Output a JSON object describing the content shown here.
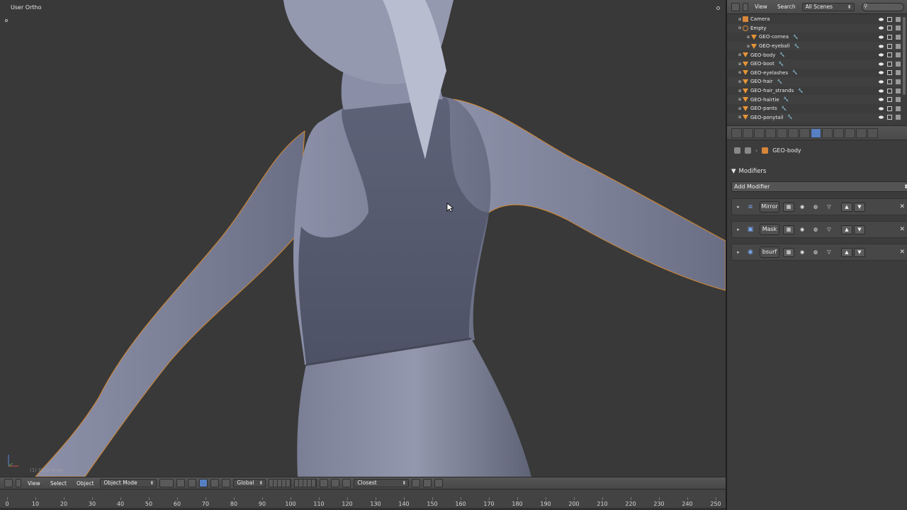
{
  "viewport": {
    "title": "User Ortho",
    "object_label": "(1) GEO-body",
    "header": {
      "view": "View",
      "select": "Select",
      "object": "Object",
      "mode": "Object Mode",
      "orientation": "Global",
      "snap": "Closest"
    }
  },
  "timeline": {
    "ticks": [
      "0",
      "10",
      "20",
      "30",
      "40",
      "50",
      "60",
      "70",
      "80",
      "90",
      "100",
      "110",
      "120",
      "130",
      "140",
      "150",
      "160",
      "170",
      "180",
      "190",
      "200",
      "210",
      "220",
      "230",
      "240",
      "250"
    ]
  },
  "outliner": {
    "view": "View",
    "search": "Search",
    "scene_select": "All Scenes",
    "items": [
      {
        "name": "Camera",
        "type": "camera"
      },
      {
        "name": "Empty",
        "type": "empty"
      },
      {
        "name": "GEO-cornea",
        "type": "mesh"
      },
      {
        "name": "GEO-eyeball",
        "type": "mesh"
      },
      {
        "name": "GEO-body",
        "type": "mesh"
      },
      {
        "name": "GEO-boot",
        "type": "mesh"
      },
      {
        "name": "GEO-eyelashes",
        "type": "mesh"
      },
      {
        "name": "GEO-hair",
        "type": "mesh"
      },
      {
        "name": "GEO-hair_strands",
        "type": "mesh"
      },
      {
        "name": "GEO-hairtie",
        "type": "mesh"
      },
      {
        "name": "GEO-pants",
        "type": "mesh"
      },
      {
        "name": "GEO-ponytail",
        "type": "mesh"
      }
    ]
  },
  "properties": {
    "context": "GEO-body",
    "panel_title": "Modifiers",
    "add_modifier": "Add Modifier",
    "modifiers": [
      {
        "name": "Mirror",
        "icon": "mirror-icon"
      },
      {
        "name": "Mask",
        "icon": "mask-icon"
      },
      {
        "name": "bsurf",
        "icon": "subsurf-icon"
      }
    ]
  },
  "colors": {
    "accent": "#5680c2",
    "selection": "#e89537"
  }
}
